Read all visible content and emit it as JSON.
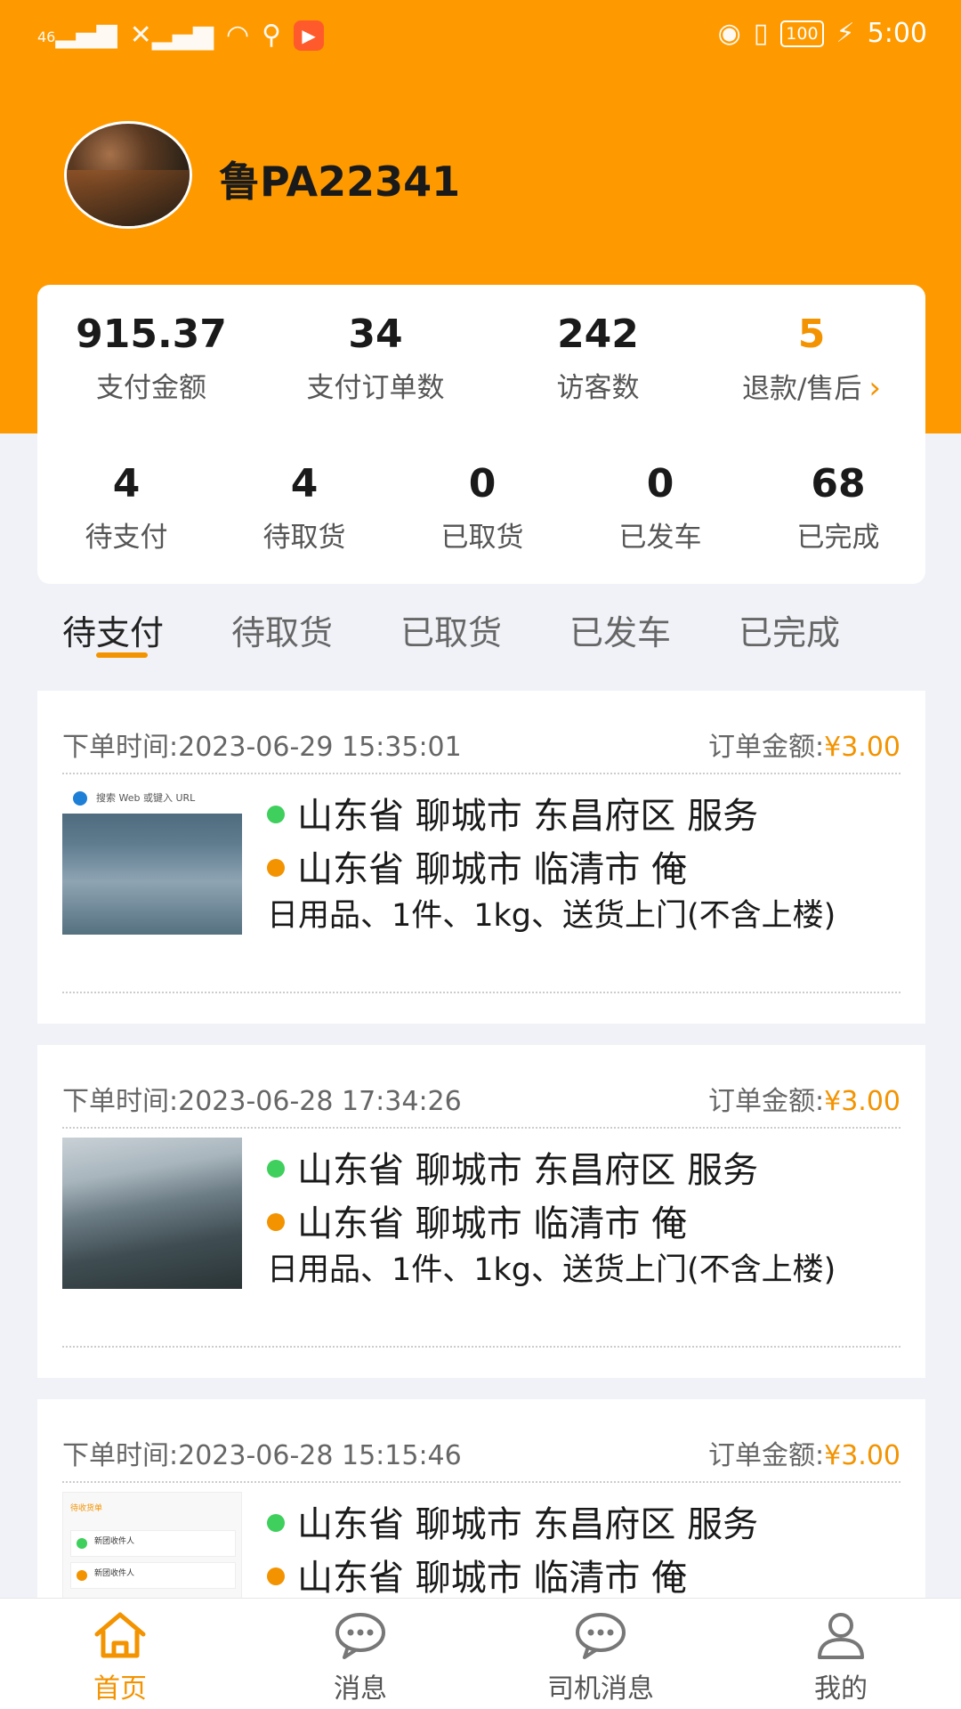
{
  "status_bar": {
    "signal1": "46",
    "battery": "100",
    "time": "5:00"
  },
  "profile": {
    "plate": "鲁PA22341"
  },
  "stats_top": [
    {
      "value": "915.37",
      "label": "支付金额"
    },
    {
      "value": "34",
      "label": "支付订单数"
    },
    {
      "value": "242",
      "label": "访客数"
    },
    {
      "value": "5",
      "label": "退款/售后"
    }
  ],
  "stats_bottom": [
    {
      "value": "4",
      "label": "待支付"
    },
    {
      "value": "4",
      "label": "待取货"
    },
    {
      "value": "0",
      "label": "已取货"
    },
    {
      "value": "0",
      "label": "已发车"
    },
    {
      "value": "68",
      "label": "已完成"
    }
  ],
  "tabs": [
    "待支付",
    "待取货",
    "已取货",
    "已发车",
    "已完成"
  ],
  "orders": [
    {
      "time_label": "下单时间:",
      "time": "2023-06-29 15:35:01",
      "amount_label": "订单金额:",
      "amount": "¥3.00",
      "from": "山东省 聊城市 东昌府区 服务",
      "to": "山东省 聊城市 临清市 俺",
      "desc": "日用品、1件、1kg、送货上门(不含上楼)",
      "thumb_text": "搜索 Web 或键入 URL"
    },
    {
      "time_label": "下单时间:",
      "time": "2023-06-28 17:34:26",
      "amount_label": "订单金额:",
      "amount": "¥3.00",
      "from": "山东省 聊城市 东昌府区 服务",
      "to": "山东省 聊城市 临清市 俺",
      "desc": "日用品、1件、1kg、送货上门(不含上楼)"
    },
    {
      "time_label": "下单时间:",
      "time": "2023-06-28 15:15:46",
      "amount_label": "订单金额:",
      "amount": "¥3.00",
      "from": "山东省 聊城市 东昌府区 服务",
      "to": "山东省 聊城市 临清市 俺",
      "thumb_tab": "待收货单",
      "thumb_row1": "新团收件人",
      "thumb_row2": "新团收件人"
    }
  ],
  "nav": [
    "首页",
    "消息",
    "司机消息",
    "我的"
  ],
  "colors": {
    "accent": "#fe9a00",
    "amount": "#f39300",
    "green_dot": "#3ecf5c"
  }
}
